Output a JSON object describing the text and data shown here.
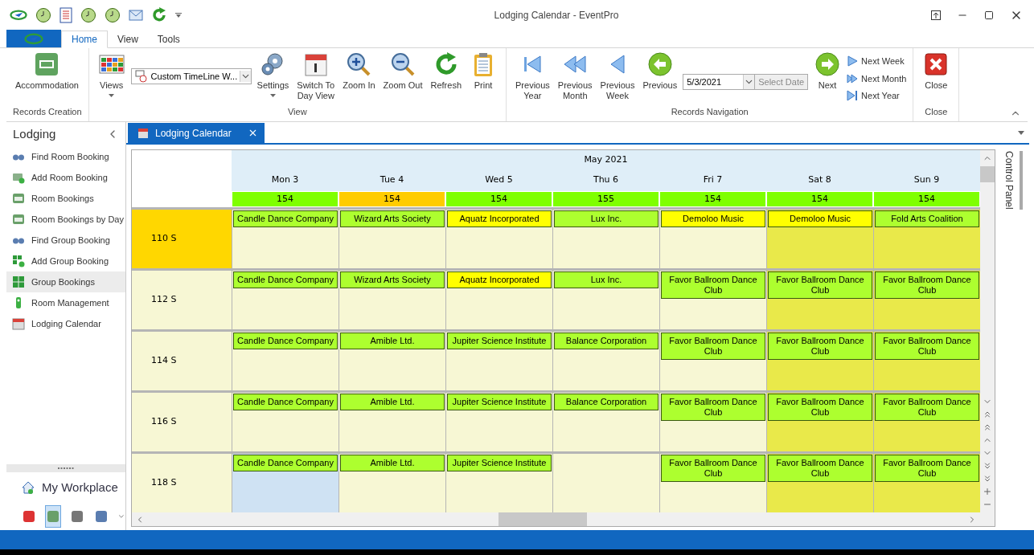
{
  "window": {
    "title": "Lodging Calendar - EventPro"
  },
  "ribbon": {
    "tabs": [
      {
        "label": "Home",
        "selected": true
      },
      {
        "label": "View",
        "selected": false
      },
      {
        "label": "Tools",
        "selected": false
      }
    ],
    "groups": [
      {
        "label": "Records Creation",
        "items": [
          {
            "kind": "large",
            "label": "Accommodation",
            "dropdown": false
          }
        ]
      },
      {
        "label": "View",
        "items": [
          {
            "kind": "large",
            "label": "Views",
            "dropdown": true
          },
          {
            "kind": "combo",
            "value": "Custom TimeLine W..."
          },
          {
            "kind": "large",
            "label": "Settings",
            "dropdown": true
          },
          {
            "kind": "large",
            "label": "Switch To\nDay View",
            "dropdown": false
          },
          {
            "kind": "large",
            "label": "Zoom In",
            "dropdown": false
          },
          {
            "kind": "large",
            "label": "Zoom Out",
            "dropdown": false
          },
          {
            "kind": "large",
            "label": "Refresh",
            "dropdown": false
          },
          {
            "kind": "large",
            "label": "Print",
            "dropdown": false
          }
        ]
      },
      {
        "label": "Records Navigation",
        "items": [
          {
            "kind": "large",
            "label": "Previous\nYear",
            "dropdown": false
          },
          {
            "kind": "large",
            "label": "Previous\nMonth",
            "dropdown": false
          },
          {
            "kind": "large",
            "label": "Previous\nWeek",
            "dropdown": false
          },
          {
            "kind": "large",
            "label": "Previous",
            "dropdown": false
          },
          {
            "kind": "date",
            "value": "5/3/2021",
            "button": "Select Date"
          },
          {
            "kind": "large",
            "label": "Next",
            "dropdown": false
          },
          {
            "kind": "stack",
            "labels": [
              "Next Week",
              "Next Month",
              "Next Year"
            ]
          }
        ]
      },
      {
        "label": "Close",
        "items": [
          {
            "kind": "large",
            "label": "Close",
            "dropdown": false
          }
        ]
      }
    ]
  },
  "sidebar": {
    "title": "Lodging",
    "items": [
      {
        "label": "Find Room Booking",
        "selected": false
      },
      {
        "label": "Add Room Booking",
        "selected": false
      },
      {
        "label": "Room Bookings",
        "selected": false
      },
      {
        "label": "Room Bookings by Day",
        "selected": false
      },
      {
        "label": "Find Group Booking",
        "selected": false
      },
      {
        "label": "Add Group Booking",
        "selected": false
      },
      {
        "label": "Group Bookings",
        "selected": true
      },
      {
        "label": "Room Management",
        "selected": false
      },
      {
        "label": "Lodging Calendar",
        "selected": false
      }
    ],
    "workplace": "My Workplace",
    "bottom_buttons": [
      {
        "selected": false
      },
      {
        "selected": true
      },
      {
        "selected": false
      },
      {
        "selected": false
      }
    ]
  },
  "document_tab": {
    "label": "Lodging Calendar"
  },
  "calendar": {
    "month": "May 2021",
    "days": [
      {
        "label": "Mon 3",
        "count": "154",
        "color": "#7fff00",
        "weekend": false
      },
      {
        "label": "Tue 4",
        "count": "154",
        "color": "#ffcc00",
        "weekend": false
      },
      {
        "label": "Wed 5",
        "count": "154",
        "color": "#7fff00",
        "weekend": false
      },
      {
        "label": "Thu 6",
        "count": "155",
        "color": "#7fff00",
        "weekend": false
      },
      {
        "label": "Fri 7",
        "count": "154",
        "color": "#7fff00",
        "weekend": false
      },
      {
        "label": "Sat 8",
        "count": "154",
        "color": "#7fff00",
        "weekend": true
      },
      {
        "label": "Sun 9",
        "count": "154",
        "color": "#7fff00",
        "weekend": true
      }
    ],
    "rooms": [
      {
        "name": "110 S",
        "selected": true,
        "cells": [
          {
            "selected": false,
            "booking": {
              "label": "Candle Dance Company",
              "color": "#adff2f"
            }
          },
          {
            "selected": false,
            "booking": {
              "label": "Wizard Arts Society",
              "color": "#adff2f"
            }
          },
          {
            "selected": false,
            "booking": {
              "label": "Aquatz Incorporated",
              "color": "#ffff00"
            }
          },
          {
            "selected": false,
            "booking": {
              "label": "Lux Inc.",
              "color": "#adff2f"
            }
          },
          {
            "selected": false,
            "booking": {
              "label": "Demoloo Music",
              "color": "#ffff00"
            }
          },
          {
            "selected": false,
            "booking": {
              "label": "Demoloo Music",
              "color": "#ffff00"
            }
          },
          {
            "selected": false,
            "booking": {
              "label": "Fold Arts Coalition",
              "color": "#adff2f"
            }
          }
        ]
      },
      {
        "name": "112 S",
        "selected": false,
        "cells": [
          {
            "selected": false,
            "booking": {
              "label": "Candle Dance Company",
              "color": "#adff2f"
            }
          },
          {
            "selected": false,
            "booking": {
              "label": "Wizard Arts Society",
              "color": "#adff2f"
            }
          },
          {
            "selected": false,
            "booking": {
              "label": "Aquatz Incorporated",
              "color": "#ffff00"
            }
          },
          {
            "selected": false,
            "booking": {
              "label": "Lux Inc.",
              "color": "#adff2f"
            }
          },
          {
            "selected": false,
            "booking": {
              "label": "Favor Ballroom Dance Club",
              "color": "#adff2f"
            }
          },
          {
            "selected": false,
            "booking": {
              "label": "Favor Ballroom Dance Club",
              "color": "#adff2f"
            }
          },
          {
            "selected": false,
            "booking": {
              "label": "Favor Ballroom Dance Club",
              "color": "#adff2f"
            }
          }
        ]
      },
      {
        "name": "114 S",
        "selected": false,
        "cells": [
          {
            "selected": false,
            "booking": {
              "label": "Candle Dance Company",
              "color": "#adff2f"
            }
          },
          {
            "selected": false,
            "booking": {
              "label": "Amible Ltd.",
              "color": "#adff2f"
            }
          },
          {
            "selected": false,
            "booking": {
              "label": "Jupiter Science Institute",
              "color": "#adff2f"
            }
          },
          {
            "selected": false,
            "booking": {
              "label": "Balance Corporation",
              "color": "#adff2f"
            }
          },
          {
            "selected": false,
            "booking": {
              "label": "Favor Ballroom Dance Club",
              "color": "#adff2f"
            }
          },
          {
            "selected": false,
            "booking": {
              "label": "Favor Ballroom Dance Club",
              "color": "#adff2f"
            }
          },
          {
            "selected": false,
            "booking": {
              "label": "Favor Ballroom Dance Club",
              "color": "#adff2f"
            }
          }
        ]
      },
      {
        "name": "116 S",
        "selected": false,
        "cells": [
          {
            "selected": false,
            "booking": {
              "label": "Candle Dance Company",
              "color": "#adff2f"
            }
          },
          {
            "selected": false,
            "booking": {
              "label": "Amible Ltd.",
              "color": "#adff2f"
            }
          },
          {
            "selected": false,
            "booking": {
              "label": "Jupiter Science Institute",
              "color": "#adff2f"
            }
          },
          {
            "selected": false,
            "booking": {
              "label": "Balance Corporation",
              "color": "#adff2f"
            }
          },
          {
            "selected": false,
            "booking": {
              "label": "Favor Ballroom Dance Club",
              "color": "#adff2f"
            }
          },
          {
            "selected": false,
            "booking": {
              "label": "Favor Ballroom Dance Club",
              "color": "#adff2f"
            }
          },
          {
            "selected": false,
            "booking": {
              "label": "Favor Ballroom Dance Club",
              "color": "#adff2f"
            }
          }
        ]
      },
      {
        "name": "118 S",
        "selected": false,
        "cells": [
          {
            "selected": true,
            "booking": {
              "label": "Candle Dance Company",
              "color": "#adff2f"
            }
          },
          {
            "selected": false,
            "booking": {
              "label": "Amible Ltd.",
              "color": "#adff2f"
            }
          },
          {
            "selected": false,
            "booking": {
              "label": "Jupiter Science Institute",
              "color": "#adff2f"
            }
          },
          {
            "selected": false
          },
          {
            "selected": false,
            "booking": {
              "label": "Favor Ballroom Dance Club",
              "color": "#adff2f"
            }
          },
          {
            "selected": false,
            "booking": {
              "label": "Favor Ballroom Dance Club",
              "color": "#adff2f"
            }
          },
          {
            "selected": false,
            "booking": {
              "label": "Favor Ballroom Dance Club",
              "color": "#adff2f"
            }
          }
        ]
      }
    ]
  },
  "control_panel": "Control Panel"
}
